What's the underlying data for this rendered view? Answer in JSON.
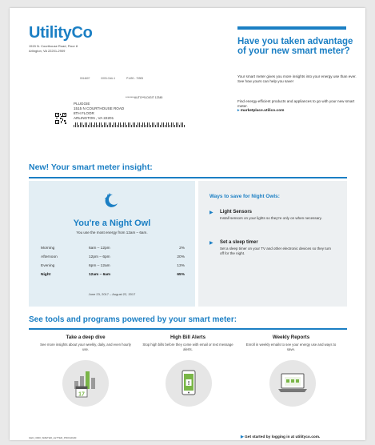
{
  "brand": {
    "logo_text": "UtilityCo",
    "return_address": [
      "1515 N. Courthouse Road, Floor 8",
      "Arlington, VA 22201-2909"
    ]
  },
  "mailing": {
    "codes": [
      "0014607",
      "0003-CAU-1",
      "P1490 - 70905"
    ],
    "autodigit": "********AUTO**5-DIGIT 12345",
    "address_lines": [
      "PLUGGIE",
      "1515 N COURTHOUSE ROAD",
      "8TH FLOOR",
      "ARLINGTON , VA 22201"
    ]
  },
  "promo": {
    "title": "Have you taken advantage of your new smart meter?",
    "body": "Your smart meter gives you more insights into your energy use than ever. See how yours can help you save!",
    "body2": "Find energy-efficient products and appliances to go with your new smart meter.",
    "link": "marketplace.utilico.com",
    "arrow": "▸"
  },
  "insight": {
    "section_title": "New! Your smart meter insight:",
    "owl_title": "You're a Night Owl",
    "owl_subtitle": "You use the most energy from 12am – 6am.",
    "rows": [
      {
        "period": "Morning",
        "time": "6am – 12pm",
        "pct": "2%",
        "highlight": false
      },
      {
        "period": "Afternoon",
        "time": "12pm – 6pm",
        "pct": "20%",
        "highlight": false
      },
      {
        "period": "Evening",
        "time": "6pm – 12am",
        "pct": "13%",
        "highlight": false
      },
      {
        "period": "Night",
        "time": "12am – 6am",
        "pct": "65%",
        "highlight": true
      }
    ],
    "date_range": "June 23, 2017 – August 22, 2017",
    "moon_icon": "moon-stars-icon"
  },
  "ways": {
    "title": "Ways to save for Night Owls:",
    "tips": [
      {
        "title": "Light Sensors",
        "desc": "Install sensors on your lights so they're only on when necessary."
      },
      {
        "title": "Set a sleep timer",
        "desc": "Set a sleep timer on your TV and other electronic devices so they turn off for the night."
      }
    ],
    "bullet": "▶"
  },
  "tools": {
    "section_title": "See tools and programs powered by your smart meter:",
    "items": [
      {
        "title": "Take a deep dive",
        "desc": "See more insights about your weekly, daily, and even hourly use.",
        "icon": "bar-chart-calendar-icon",
        "calendar_day": "17"
      },
      {
        "title": "High Bill Alerts",
        "desc": "Stop high bills before they come with email or text message alerts.",
        "icon": "phone-alert-icon",
        "alert_mark": "!"
      },
      {
        "title": "Weekly Reports",
        "desc": "Enroll in weekly emails to see your energy use and ways to save.",
        "icon": "laptop-report-icon"
      }
    ]
  },
  "cta": {
    "arrow": "▶",
    "text": "Get started by logging in at utilityco.com."
  },
  "footer": {
    "code": "GEN_3000_SMETER_LETTER_PROGRAM"
  },
  "colors": {
    "brand_blue": "#1b7fc4",
    "green": "#7ab648",
    "panel_blue": "#e3eef4",
    "panel_gray": "#edf0f2"
  }
}
